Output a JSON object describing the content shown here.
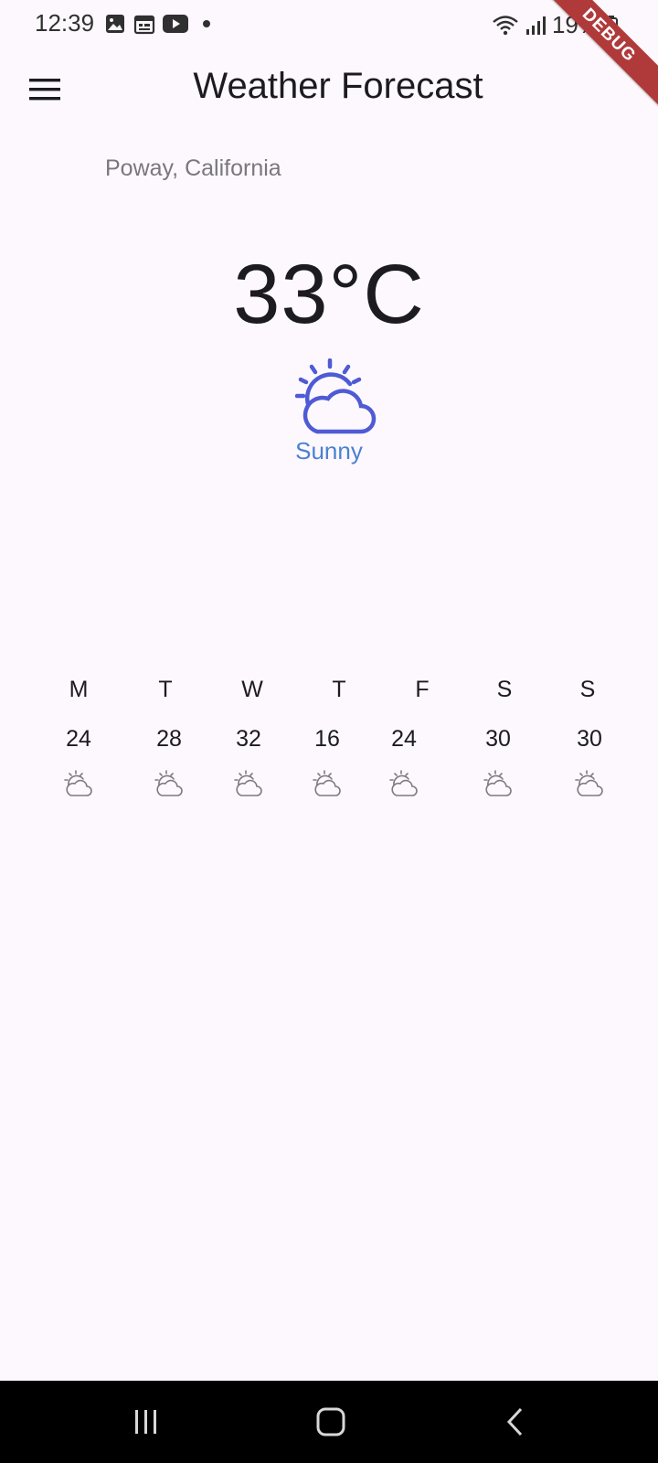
{
  "status_bar": {
    "time": "12:39",
    "battery": "19%",
    "left_icons": [
      "image-icon",
      "calendar-icon",
      "youtube-icon",
      "notification-dot-icon"
    ],
    "right_icons": [
      "wifi-icon",
      "signal-icon",
      "battery-icon"
    ]
  },
  "debug_banner": "DEBUG",
  "app_bar": {
    "title": "Weather Forecast",
    "menu_icon": "hamburger-menu-icon"
  },
  "location": "Poway, California",
  "current": {
    "temperature": "33°C",
    "condition": "Sunny",
    "icon": "partly-sunny-icon",
    "icon_color": "#4f5bd5",
    "condition_color": "#4a80d4"
  },
  "forecast": [
    {
      "day": "M",
      "temp": "24",
      "icon": "partly-sunny-icon"
    },
    {
      "day": "T",
      "temp": "28",
      "icon": "partly-sunny-icon"
    },
    {
      "day": "W",
      "temp": "32",
      "icon": "partly-sunny-icon"
    },
    {
      "day": "T",
      "temp": "16",
      "icon": "partly-sunny-icon"
    },
    {
      "day": "F",
      "temp": "24",
      "icon": "partly-sunny-icon"
    },
    {
      "day": "S",
      "temp": "30",
      "icon": "partly-sunny-icon"
    },
    {
      "day": "S",
      "temp": "30",
      "icon": "partly-sunny-icon"
    }
  ],
  "nav_bar": {
    "buttons": [
      "recent-apps-icon",
      "home-icon",
      "back-icon"
    ]
  }
}
